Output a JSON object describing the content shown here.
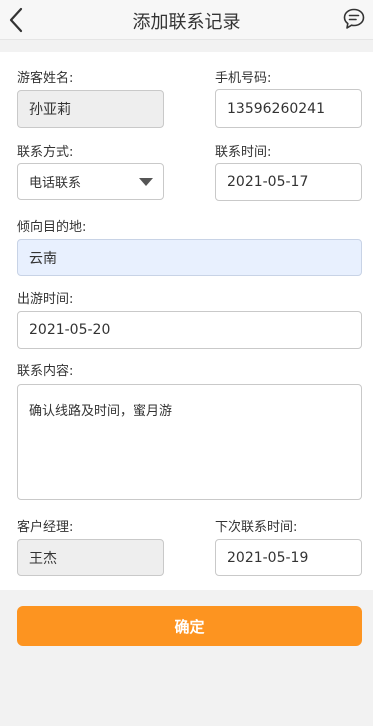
{
  "header": {
    "title": "添加联系记录",
    "back_icon": "chevron-left-icon",
    "message_icon": "chat-bubble-icon"
  },
  "form": {
    "visitor_name": {
      "label": "游客姓名:",
      "value": "孙亚莉"
    },
    "phone": {
      "label": "手机号码:",
      "value": "13596260241"
    },
    "contact_method": {
      "label": "联系方式:",
      "selected": "电话联系"
    },
    "contact_time": {
      "label": "联系时间:",
      "value": "2021-05-17"
    },
    "destination": {
      "label": "倾向目的地:",
      "value": "云南"
    },
    "travel_time": {
      "label": "出游时间:",
      "value": "2021-05-20"
    },
    "content": {
      "label": "联系内容:",
      "value": "确认线路及时间，蜜月游"
    },
    "manager": {
      "label": "客户经理:",
      "value": "王杰"
    },
    "next_contact_time": {
      "label": "下次联系时间:",
      "value": "2021-05-19"
    }
  },
  "actions": {
    "confirm_label": "确定"
  },
  "colors": {
    "accent": "#fd9420",
    "highlight": "#e8f0fe"
  }
}
